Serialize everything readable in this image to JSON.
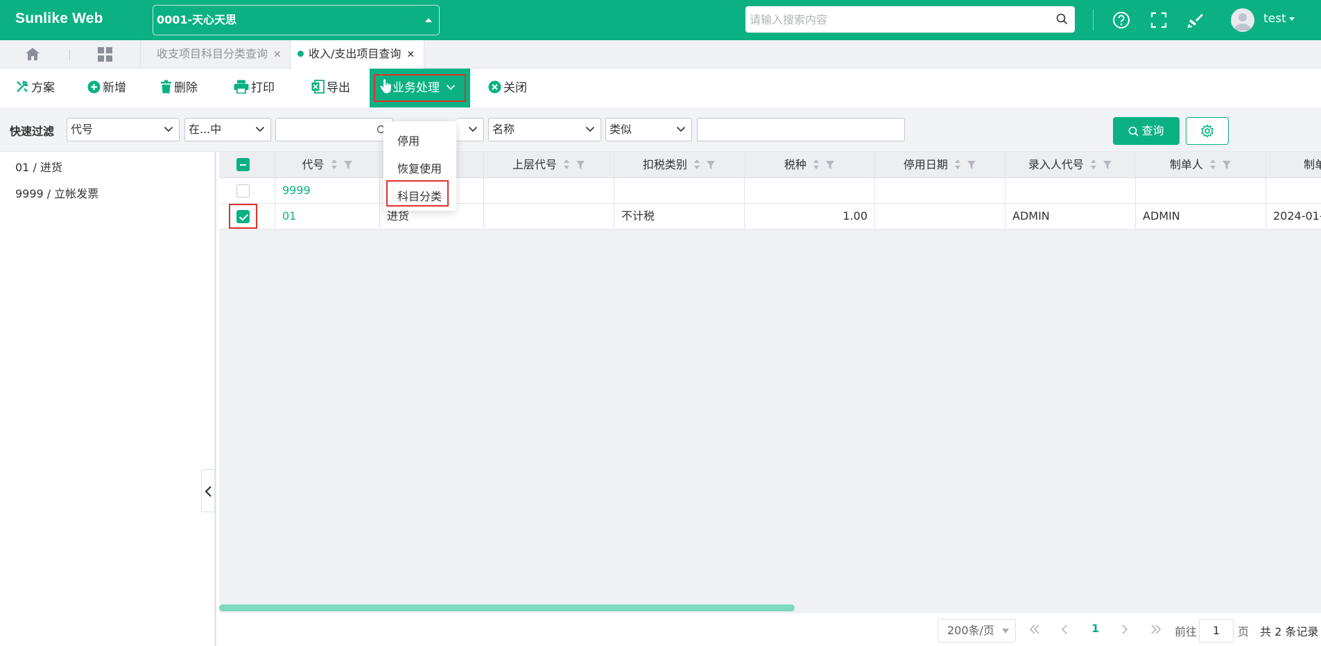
{
  "app": {
    "title": "Sunlike Web"
  },
  "header": {
    "company": "0001-天心天思",
    "search_placeholder": "请输入搜索内容",
    "user": "test"
  },
  "tabs": [
    {
      "label": "收支项目科目分类查询"
    },
    {
      "label": "收入/支出项目查询"
    }
  ],
  "toolbar": {
    "plan": "方案",
    "add": "新增",
    "delete": "删除",
    "print": "打印",
    "export": "导出",
    "business": "业务处理",
    "close": "关闭"
  },
  "dropdown": {
    "items": [
      "停用",
      "恢复使用",
      "科目分类"
    ]
  },
  "filter": {
    "label": "快速过滤",
    "field1": "代号",
    "op1": "在...中",
    "field2": "名称",
    "op2": "类似",
    "query": "查询"
  },
  "tree": {
    "items": [
      "01 / 进货",
      "9999 / 立帐发票"
    ]
  },
  "grid": {
    "columns": [
      "代号",
      "",
      "上层代号",
      "扣税类别",
      "税种",
      "停用日期",
      "录入人代号",
      "制单人",
      "制单"
    ],
    "rows": [
      {
        "checked": false,
        "code": "9999",
        "name": "",
        "parent": "",
        "tax_type": "",
        "tax_kind": "",
        "stop_date": "",
        "entry_code": "",
        "maker": "",
        "make_date": ""
      },
      {
        "checked": true,
        "code": "01",
        "name": "进货",
        "parent": "",
        "tax_type": "不计税",
        "tax_kind": "1.00",
        "stop_date": "",
        "entry_code": "ADMIN",
        "maker": "ADMIN",
        "make_date": "2024-01-"
      }
    ]
  },
  "pager": {
    "size": "200条/页",
    "current": "1",
    "goto_prefix": "前往",
    "goto_value": "1",
    "goto_suffix": "页",
    "total": "共 2 条记录"
  },
  "colors": {
    "primary": "#0bb183",
    "highlight": "#e0312d"
  }
}
